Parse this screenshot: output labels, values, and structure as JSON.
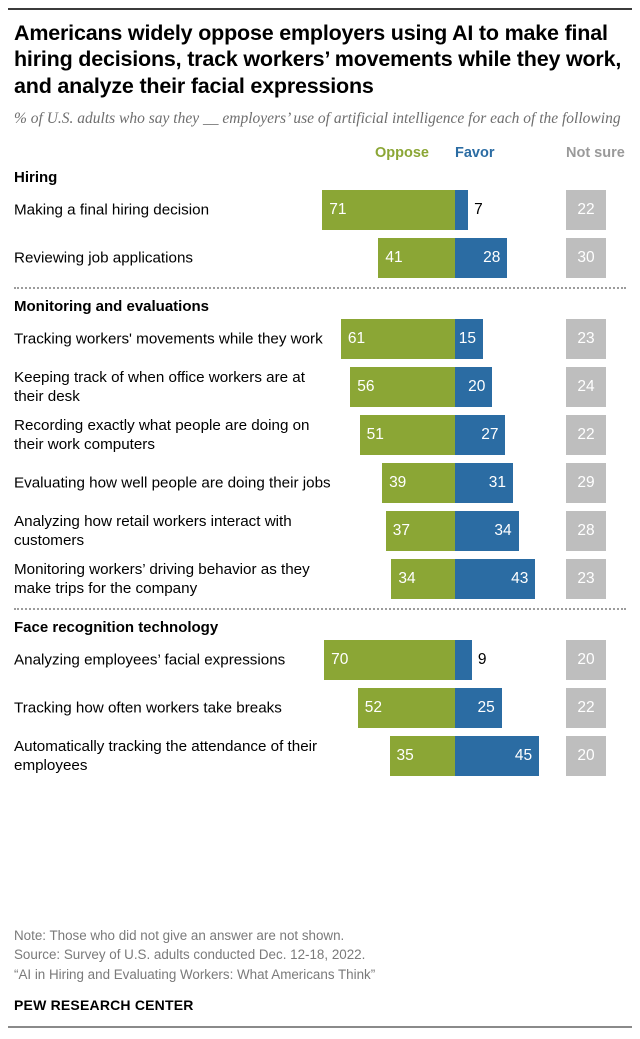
{
  "title": "Americans widely oppose employers using AI to make final hiring decisions, track workers’ movements while they work, and analyze their facial expressions",
  "subtitle": "% of U.S. adults who say they __ employers’ use of artificial intelligence for each of the following",
  "legend": {
    "oppose": "Oppose",
    "favor": "Favor",
    "not_sure": "Not sure"
  },
  "colors": {
    "oppose": "#8BA635",
    "favor": "#2B6CA3",
    "not_sure": "#BEBEBE",
    "subtitle": "#6E6E6E",
    "note": "#7A7A7A"
  },
  "footer": {
    "note": "Note: Those who did not give an answer are not shown.",
    "source": "Source: Survey of U.S. adults conducted Dec. 12-18, 2022.",
    "report": "“AI in Hiring and Evaluating Workers: What Americans Think”",
    "brand": "PEW RESEARCH CENTER"
  },
  "chart_data": {
    "type": "bar",
    "subtype": "diverging-stacked-bar",
    "title": "Americans widely oppose employers using AI to make final hiring decisions, track workers’ movements while they work, and analyze their facial expressions",
    "subtitle": "% of U.S. adults who say they __ employers’ use of artificial intelligence for each of the following",
    "series": [
      {
        "name": "Oppose",
        "color": "#8BA635"
      },
      {
        "name": "Favor",
        "color": "#2B6CA3"
      },
      {
        "name": "Not sure",
        "color": "#BEBEBE"
      }
    ],
    "legend_position": "top-right",
    "grid": false,
    "value_unit": "percent",
    "sections": [
      {
        "heading": "Hiring",
        "rows": [
          {
            "label": "Making a final hiring decision",
            "oppose": 71,
            "favor": 7,
            "not_sure": 22
          },
          {
            "label": "Reviewing job applications",
            "oppose": 41,
            "favor": 28,
            "not_sure": 30
          }
        ]
      },
      {
        "heading": "Monitoring and evaluations",
        "rows": [
          {
            "label": "Tracking workers' movements while they work",
            "oppose": 61,
            "favor": 15,
            "not_sure": 23
          },
          {
            "label": "Keeping track of when office workers are at their desk",
            "oppose": 56,
            "favor": 20,
            "not_sure": 24
          },
          {
            "label": "Recording exactly what people are doing on their work computers",
            "oppose": 51,
            "favor": 27,
            "not_sure": 22
          },
          {
            "label": "Evaluating how well people are doing their jobs",
            "oppose": 39,
            "favor": 31,
            "not_sure": 29
          },
          {
            "label": "Analyzing how retail workers interact with customers",
            "oppose": 37,
            "favor": 34,
            "not_sure": 28
          },
          {
            "label": "Monitoring workers’ driving behavior as they make trips for the company",
            "oppose": 34,
            "favor": 43,
            "not_sure": 23
          }
        ]
      },
      {
        "heading": "Face recognition technology",
        "rows": [
          {
            "label": "Analyzing employees’ facial expressions",
            "oppose": 70,
            "favor": 9,
            "not_sure": 20
          },
          {
            "label": "Tracking how often workers take breaks",
            "oppose": 52,
            "favor": 25,
            "not_sure": 22
          },
          {
            "label": "Automatically tracking the attendance of their employees",
            "oppose": 35,
            "favor": 45,
            "not_sure": 20
          }
        ]
      }
    ]
  }
}
